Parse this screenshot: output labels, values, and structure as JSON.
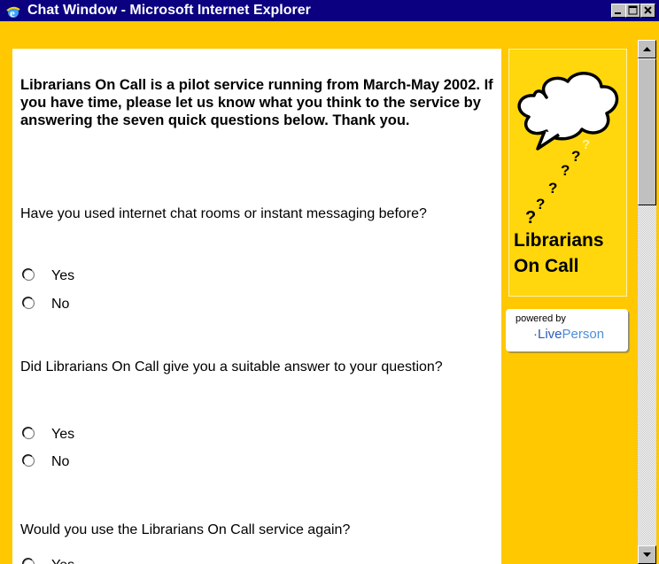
{
  "window": {
    "title": "Chat Window - Microsoft Internet Explorer"
  },
  "intro": "Librarians On Call is a pilot service running from March-May 2002. If you have time, please let us know what you think to the service by answering the seven quick questions below. Thank you.",
  "questions": [
    {
      "text": "Have you used internet chat rooms or instant messaging before?",
      "options": [
        "Yes",
        "No"
      ]
    },
    {
      "text": "Did Librarians On Call give you a suitable answer to your question?",
      "options": [
        "Yes",
        "No"
      ]
    },
    {
      "text": "Would you use the Librarians On Call service again?",
      "options": [
        "Yes"
      ]
    }
  ],
  "sidebar": {
    "logo_line1": "Librarians",
    "logo_line2": "On Call",
    "powered_by": "powered by",
    "liveperson_l": "L",
    "liveperson_ive": "ive",
    "liveperson_person": "Person"
  },
  "colors": {
    "background": "#ffc800",
    "title_bar": "#0a0080",
    "logo_box": "#ffd70c"
  },
  "icons": {
    "window_icon": "ie-icon",
    "minimize": "minimize-icon",
    "maximize": "maximize-icon",
    "close": "close-icon",
    "logo_art": "speech-bubble-question-marks-icon"
  }
}
